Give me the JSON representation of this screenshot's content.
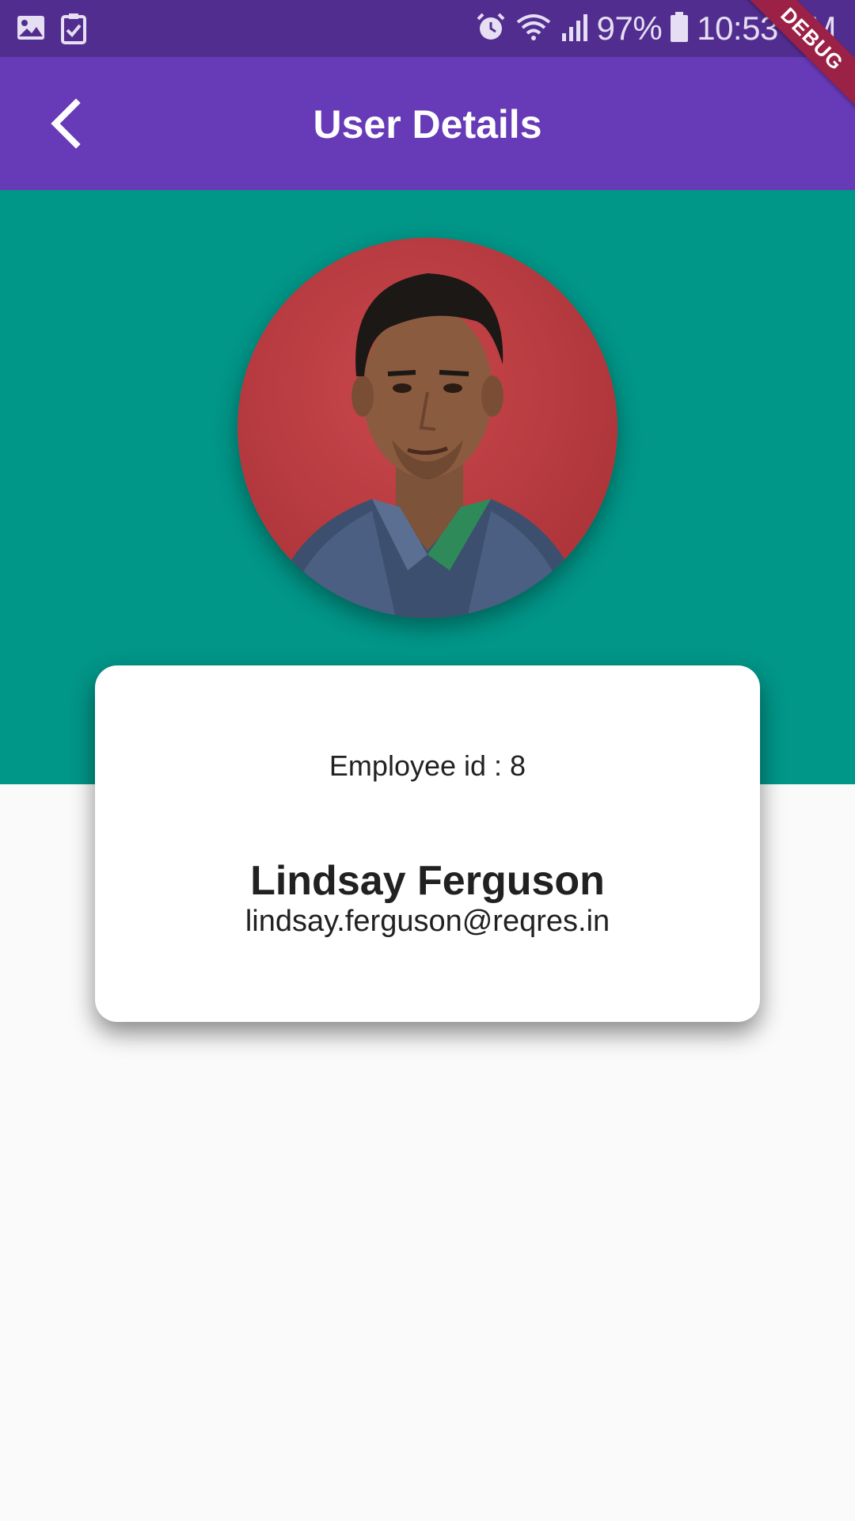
{
  "status_bar": {
    "battery": "97%",
    "time": "10:53 PM",
    "icons": [
      "gallery-icon",
      "task-icon",
      "alarm-icon",
      "wifi-icon",
      "signal-icon",
      "battery-icon"
    ]
  },
  "app_bar": {
    "title": "User Details",
    "back_icon": "chevron-left-icon"
  },
  "debug_banner": {
    "label": "DEBUG"
  },
  "profile": {
    "employee_id_text": "Employee id : 8",
    "name": "Lindsay Ferguson",
    "email": "lindsay.ferguson@reqres.in"
  },
  "colors": {
    "status_bar": "#512d90",
    "app_bar": "#673ab7",
    "header": "#009688",
    "card": "#ffffff",
    "page_bg": "#fafafa",
    "debug_banner": "#9b2147"
  }
}
